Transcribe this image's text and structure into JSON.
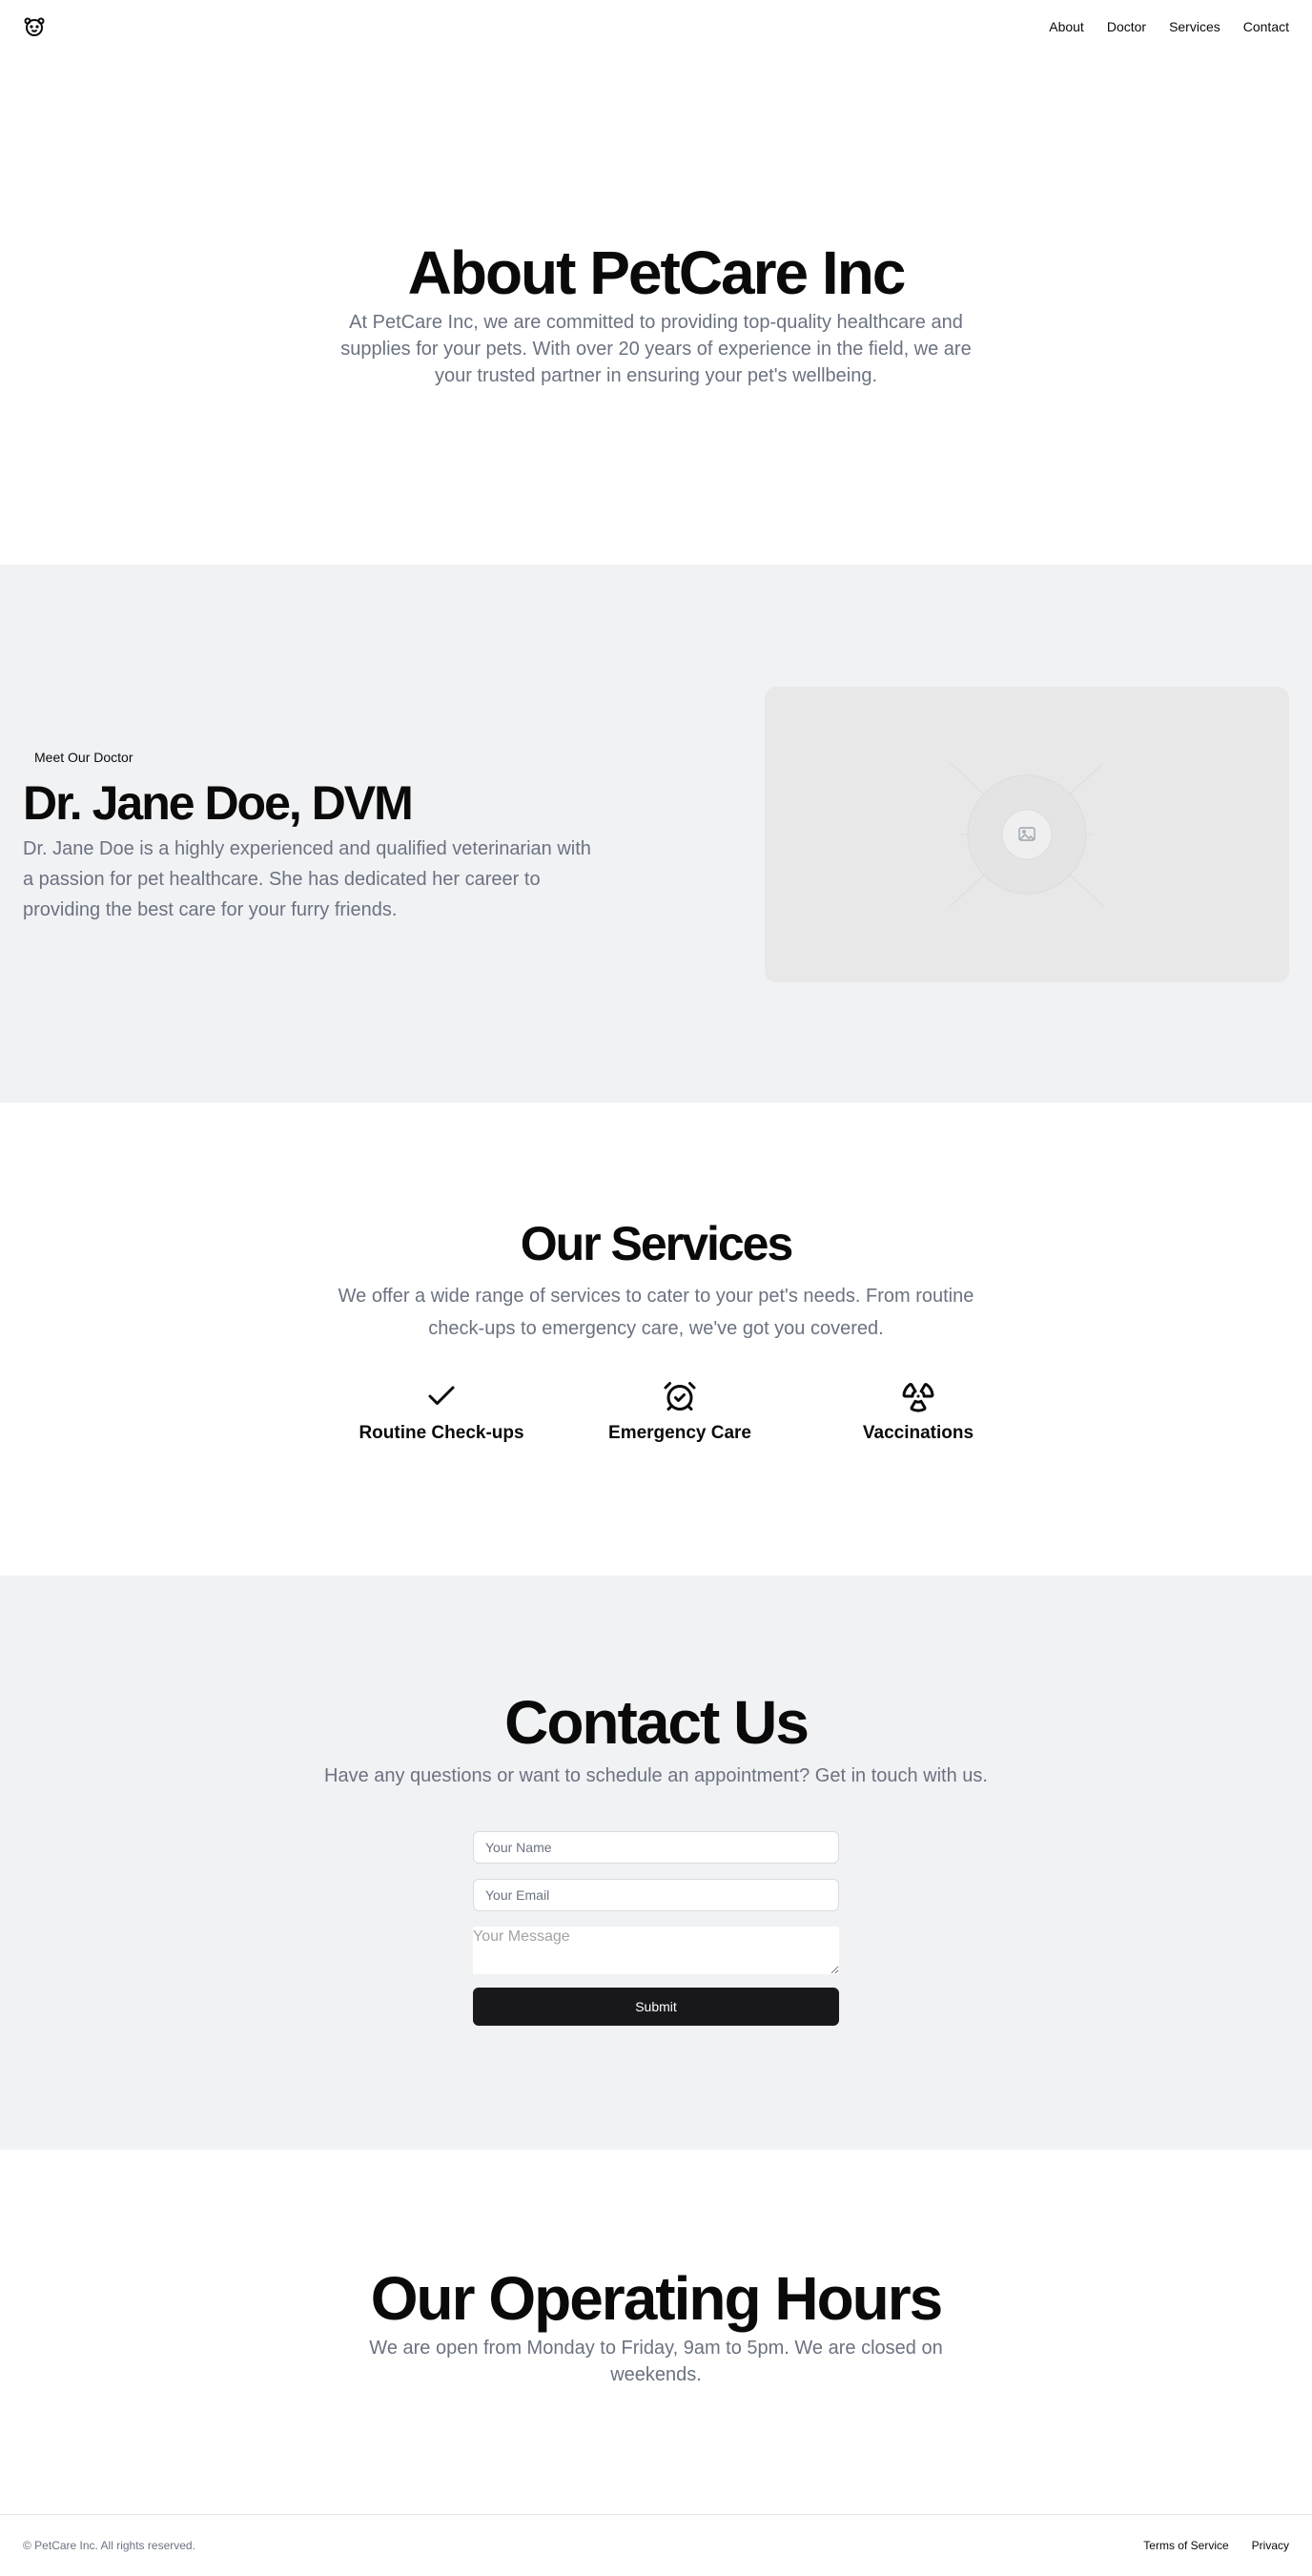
{
  "nav": {
    "logo_icon": "pet-face-icon",
    "items": [
      {
        "label": "About"
      },
      {
        "label": "Doctor"
      },
      {
        "label": "Services"
      },
      {
        "label": "Contact"
      }
    ]
  },
  "about": {
    "title": "About PetCare Inc",
    "description": "At PetCare Inc, we are committed to providing top-quality healthcare and supplies for your pets. With over 20 years of experience in the field, we are your trusted partner in ensuring your pet's wellbeing."
  },
  "doctor": {
    "badge": "Meet Our Doctor",
    "name": "Dr. Jane Doe, DVM",
    "description": "Dr. Jane Doe is a highly experienced and qualified veterinarian with a passion for pet healthcare. She has dedicated her career to providing the best care for your furry friends.",
    "image_icon": "image-placeholder-icon"
  },
  "services": {
    "title": "Our Services",
    "description": "We offer a wide range of services to cater to your pet's needs. From routine check-ups to emergency care, we've got you covered.",
    "items": [
      {
        "label": "Routine Check-ups",
        "icon": "check-icon"
      },
      {
        "label": "Emergency Care",
        "icon": "alarm-clock-check-icon"
      },
      {
        "label": "Vaccinations",
        "icon": "radiation-icon"
      }
    ]
  },
  "contact": {
    "title": "Contact Us",
    "description": "Have any questions or want to schedule an appointment? Get in touch with us.",
    "name_placeholder": "Your Name",
    "email_placeholder": "Your Email",
    "message_placeholder": "Your Message",
    "submit_label": "Submit"
  },
  "hours": {
    "title": "Our Operating Hours",
    "description": "We are open from Monday to Friday, 9am to 5pm. We are closed on weekends."
  },
  "footer": {
    "copyright": "© PetCare Inc. All rights reserved.",
    "links": [
      {
        "label": "Terms of Service"
      },
      {
        "label": "Privacy"
      }
    ]
  },
  "colors": {
    "accent": "#18181b",
    "muted_text": "#6b7280",
    "section_alt_bg": "#f1f2f4"
  }
}
